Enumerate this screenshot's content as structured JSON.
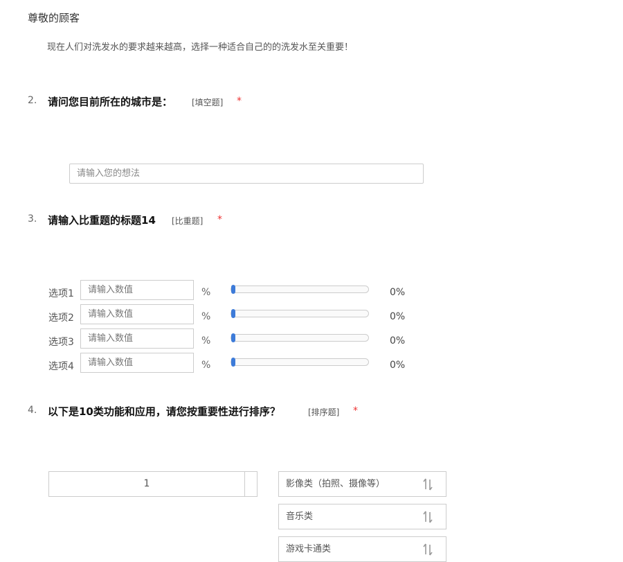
{
  "header": {
    "greeting": "尊敬的顾客",
    "intro": "现在人们对洗发水的要求越来越高，选择一种适合自己的的洗发水至关重要！"
  },
  "q2": {
    "number": "2.",
    "title": "请问您目前所在的城市是：",
    "type": "[填空题]",
    "required": "*",
    "placeholder": "请输入您的想法"
  },
  "q3": {
    "number": "3.",
    "title": "请输入比重题的标题14",
    "type": "[比重题]",
    "required": "*",
    "options": [
      {
        "label": "选项1",
        "placeholder": "请输入数值",
        "unit": "%",
        "value": 0,
        "value_text": "0%"
      },
      {
        "label": "选项2",
        "placeholder": "请输入数值",
        "unit": "%",
        "value": 0,
        "value_text": "0%"
      },
      {
        "label": "选项3",
        "placeholder": "请输入数值",
        "unit": "%",
        "value": 0,
        "value_text": "0%"
      },
      {
        "label": "选项4",
        "placeholder": "请输入数值",
        "unit": "%",
        "value": 0,
        "value_text": "0%"
      }
    ],
    "accent_color": "#3d7bd9"
  },
  "q4": {
    "number": "4.",
    "title": "以下是10类功能和应用，请您按重要性进行排序？",
    "type": "[排序题]",
    "required": "*",
    "rank_slot": "1",
    "items": [
      {
        "label": "影像类（拍照、摄像等）",
        "icon": "sort-icon"
      },
      {
        "label": "音乐类",
        "icon": "sort-icon"
      },
      {
        "label": "游戏卡通类",
        "icon": "sort-icon"
      }
    ]
  },
  "colors": {
    "required": "#ee3333",
    "border": "#cccccc"
  }
}
